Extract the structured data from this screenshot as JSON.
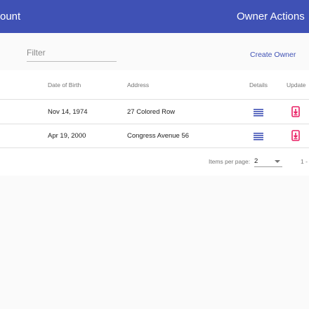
{
  "header": {
    "left_title": "ount",
    "right_title": "Owner Actions"
  },
  "toolbar": {
    "filter_placeholder": "Filter",
    "create_label": "Create Owner"
  },
  "table": {
    "columns": {
      "dob": "Date of Birth",
      "address": "Address",
      "details": "Details",
      "update": "Update"
    },
    "rows": [
      {
        "dob": "Nov 14, 1974",
        "address": "27 Colored Row",
        "details_icon": "list-icon",
        "update_icon": "update-icon"
      },
      {
        "dob": "Apr 19, 2000",
        "address": "Congress Avenue 56",
        "details_icon": "list-icon",
        "update_icon": "update-icon"
      }
    ]
  },
  "paginator": {
    "items_per_page_label": "Items per page:",
    "page_size": "2",
    "range_label": "1 -"
  },
  "colors": {
    "primary": "#3f51b5",
    "accent_pink": "#e91e63",
    "background": "#fafafa"
  }
}
